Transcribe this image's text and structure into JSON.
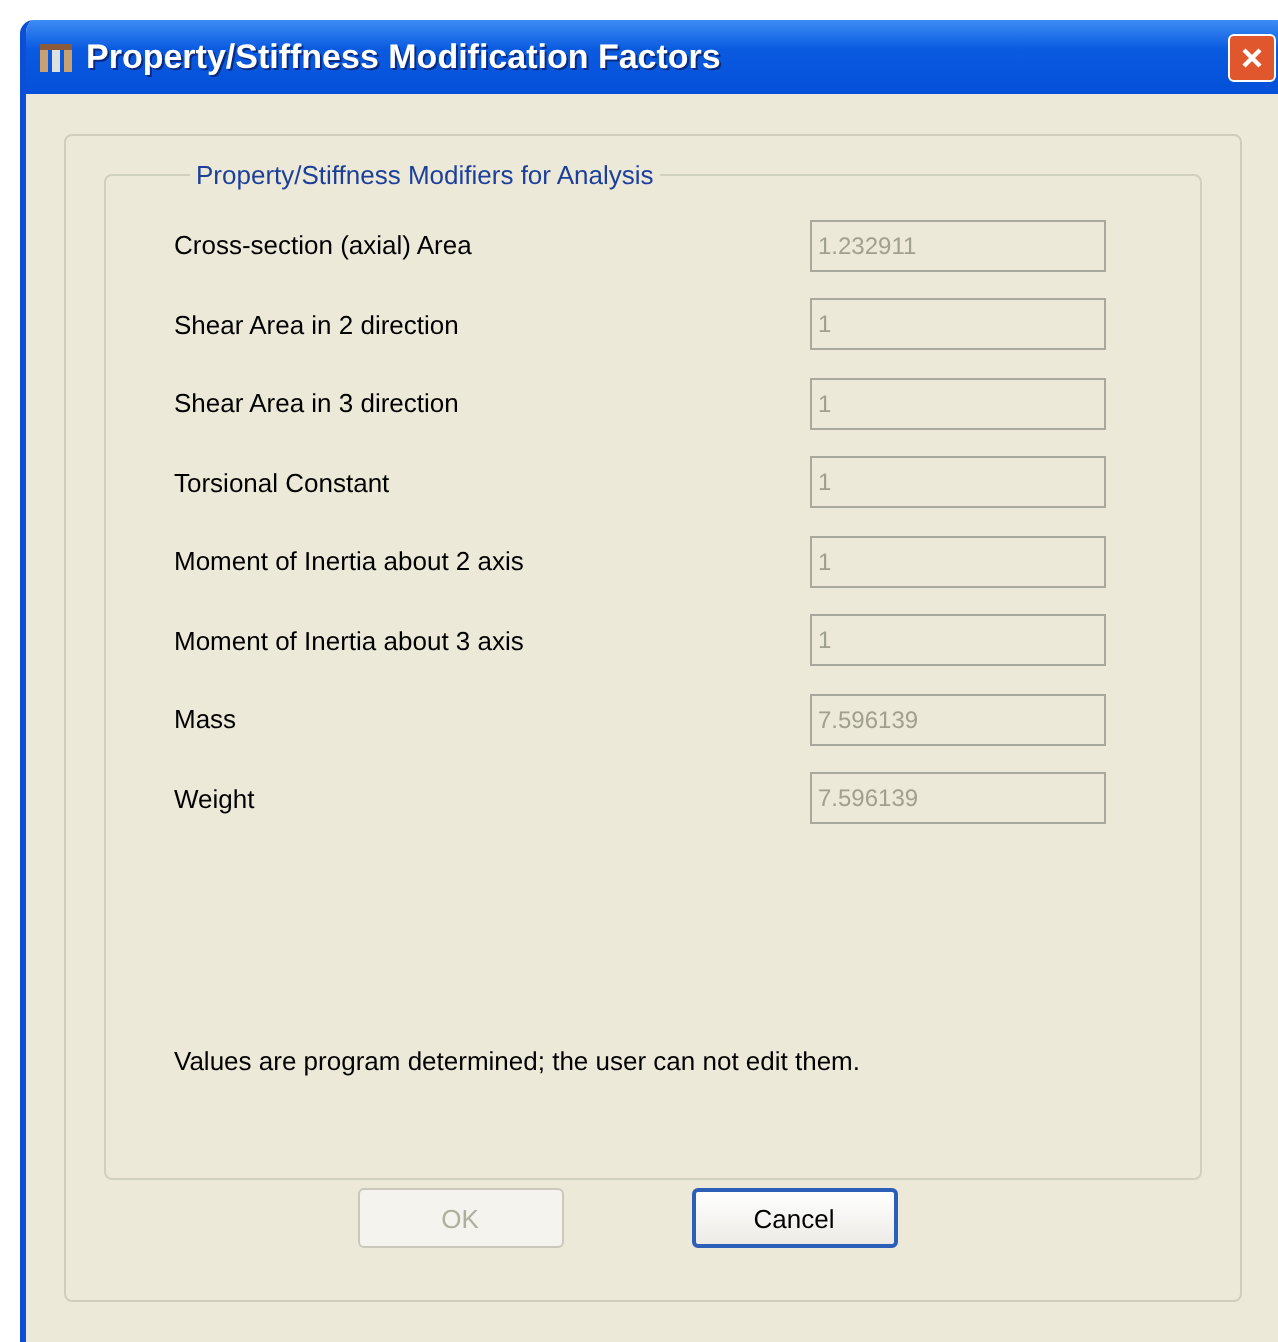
{
  "window": {
    "title": "Property/Stiffness Modification Factors"
  },
  "group": {
    "title": "Property/Stiffness Modifiers for Analysis"
  },
  "fields": [
    {
      "label": "Cross-section (axial) Area",
      "value": "1.232911",
      "disabled": true
    },
    {
      "label": "Shear Area in 2 direction",
      "value": "1",
      "disabled": true
    },
    {
      "label": "Shear Area in 3 direction",
      "value": "1",
      "disabled": true
    },
    {
      "label": "Torsional Constant",
      "value": "1",
      "disabled": true
    },
    {
      "label": "Moment of Inertia about 2 axis",
      "value": "1",
      "disabled": true
    },
    {
      "label": "Moment of Inertia about 3 axis",
      "value": "1",
      "disabled": true
    },
    {
      "label": "Mass",
      "value": "7.596139",
      "disabled": true
    },
    {
      "label": "Weight",
      "value": "7.596139",
      "disabled": true
    }
  ],
  "note": "Values are program determined; the user can not edit them.",
  "buttons": [
    {
      "label": "OK",
      "disabled": true
    },
    {
      "label": "Cancel",
      "disabled": false
    }
  ]
}
